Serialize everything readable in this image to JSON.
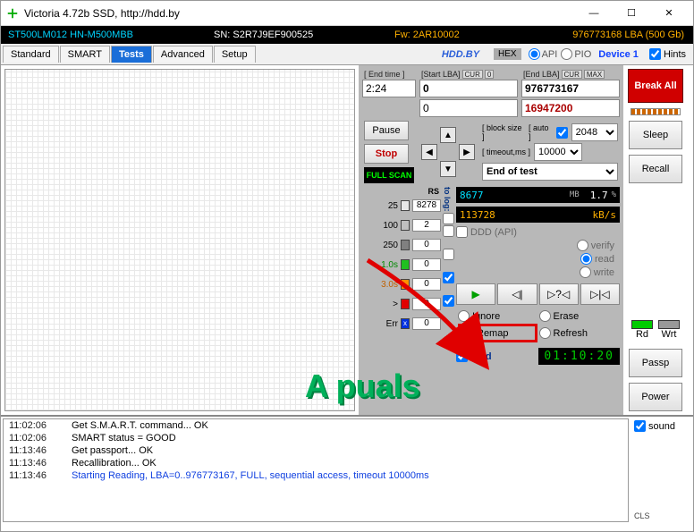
{
  "window": {
    "title": "Victoria 4.72b SSD, http://hdd.by"
  },
  "info": {
    "model": "ST500LM012 HN-M500MBB",
    "sn": "SN: S2R7J9EF900525",
    "fw": "Fw: 2AR10002",
    "lba": "976773168 LBA (500 Gb)"
  },
  "tabs": {
    "t0": "Standard",
    "t1": "SMART",
    "t2": "Tests",
    "t3": "Advanced",
    "t4": "Setup"
  },
  "topright": {
    "hddby": "HDD.BY",
    "hex": "HEX",
    "api": "API",
    "pio": "PIO",
    "device": "Device 1",
    "hints": "Hints"
  },
  "scan": {
    "endtime_lbl": "[ End time ]",
    "endtime": "2:24",
    "startlba_lbl": "[Start LBA]",
    "cur1": "CUR",
    "start1": "0",
    "start2": "0",
    "endlba_lbl": "[End LBA]",
    "cur2": "CUR",
    "max": "MAX",
    "end1": "976773167",
    "end2": "16947200",
    "pause": "Pause",
    "stop": "Stop",
    "fullscan": "FULL SCAN",
    "blocksize_lbl": "[ block size ]",
    "auto_lbl": "[ auto ]",
    "blocksize": "2048",
    "timeout_lbl": "[ timeout,ms ]",
    "timeout": "10000",
    "endoftest": "End of test"
  },
  "side": {
    "break": "Break All",
    "sleep": "Sleep",
    "recall": "Recall",
    "passp": "Passp",
    "power": "Power",
    "rd": "Rd",
    "wrt": "Wrt"
  },
  "stats": {
    "rs": "RS",
    "tolog": "to log:",
    "l0": "25",
    "v0": "8278",
    "c0": "#e0e0e0",
    "l1": "100",
    "v1": "2",
    "c1": "#c0c0c0",
    "l2": "250",
    "v2": "0",
    "c2": "#808080",
    "l3": "1.0s",
    "v3": "0",
    "c3": "#20c020",
    "l4": "3.0s",
    "v4": "0",
    "c4": "#ff9000",
    "l5": ">",
    "v5": "0",
    "c5": "#e00000",
    "l6": "Err",
    "v6": "0",
    "c6": "#0030e0"
  },
  "lcd": {
    "mb_val": "8677",
    "mb_lbl": "MB",
    "pct": "1.7",
    "pct_lbl": "%",
    "kbs_val": "113728",
    "kbs_lbl": "kB/s"
  },
  "ddd": {
    "label": "DDD (API)",
    "verify": "verify",
    "read": "read",
    "write": "write"
  },
  "errmode": {
    "ignore": "Ignore",
    "erase": "Erase",
    "remap": "Remap",
    "refresh": "Refresh"
  },
  "grid": {
    "label": "Grid",
    "timer": "01:10:20"
  },
  "log": {
    "r0t": "11:02:06",
    "r0m": "Get S.M.A.R.T. command... OK",
    "r1t": "11:02:06",
    "r1m": "SMART status = GOOD",
    "r2t": "11:13:46",
    "r2m": "Get passport... OK",
    "r3t": "11:13:46",
    "r3m": "Recallibration... OK",
    "r4t": "11:13:46",
    "r4m": "Starting Reading, LBA=0..976773167, FULL, sequential access, timeout 10000ms"
  },
  "sound": {
    "label": "sound",
    "cls": "CLS"
  },
  "watermark": "A  puals"
}
